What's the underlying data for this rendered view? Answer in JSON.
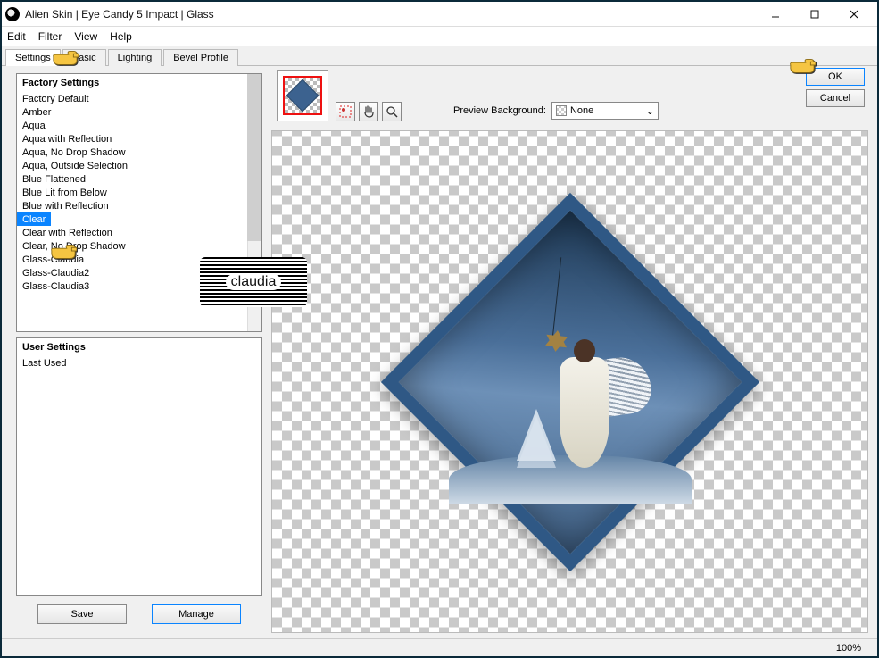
{
  "window": {
    "title": "Alien Skin | Eye Candy 5 Impact | Glass"
  },
  "menu": {
    "edit": "Edit",
    "filter": "Filter",
    "view": "View",
    "help": "Help"
  },
  "tabs": {
    "settings": "Settings",
    "basic": "Basic",
    "lighting": "Lighting",
    "bevel": "Bevel Profile"
  },
  "factory": {
    "header": "Factory Settings",
    "items": [
      "Factory Default",
      "Amber",
      "Aqua",
      "Aqua with Reflection",
      "Aqua, No Drop Shadow",
      "Aqua, Outside Selection",
      "Blue Flattened",
      "Blue Lit from Below",
      "Blue with Reflection",
      "Clear",
      "Clear with Reflection",
      "Clear, No Drop Shadow",
      "Glass-Claudia",
      "Glass-Claudia2",
      "Glass-Claudia3"
    ],
    "selected_index": 9
  },
  "user": {
    "header": "User Settings",
    "last_used": "Last Used"
  },
  "buttons": {
    "save": "Save",
    "manage": "Manage",
    "ok": "OK",
    "cancel": "Cancel"
  },
  "preview": {
    "bg_label": "Preview Background:",
    "bg_value": "None"
  },
  "status": {
    "zoom": "100%"
  },
  "watermark": "claudia"
}
